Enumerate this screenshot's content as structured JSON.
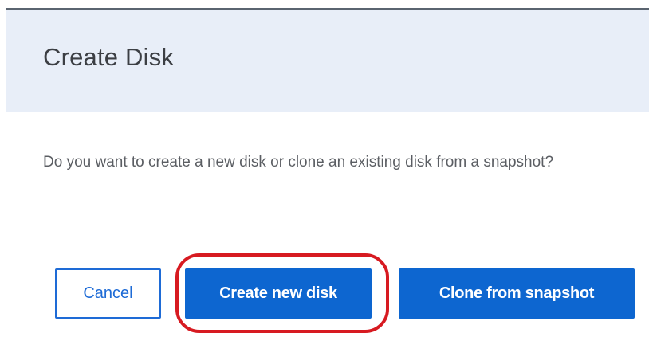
{
  "dialog": {
    "title": "Create Disk",
    "message": "Do you want to create a new disk or clone an existing disk from a snapshot?",
    "buttons": {
      "cancel": "Cancel",
      "create_new": "Create new disk",
      "clone": "Clone from snapshot"
    }
  },
  "colors": {
    "header_background": "#e8eef8",
    "primary": "#0d66d0",
    "highlight": "#d71a21"
  }
}
